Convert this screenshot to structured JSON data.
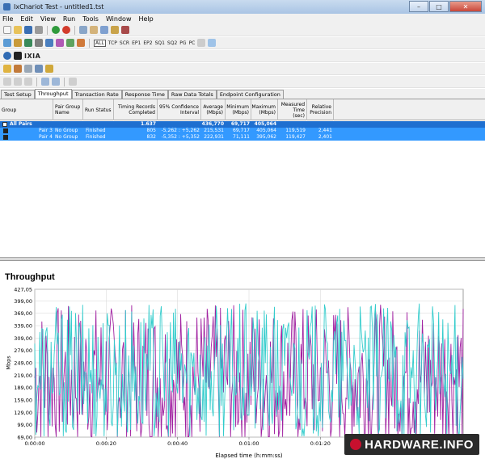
{
  "window": {
    "title": "IxChariot Test - untitled1.tst",
    "buttons": [
      "–",
      "□",
      "✕"
    ]
  },
  "menu": [
    "File",
    "Edit",
    "View",
    "Run",
    "Tools",
    "Window",
    "Help"
  ],
  "toolbar2_protocols": [
    "ALL",
    "TCP",
    "SCR",
    "EP1",
    "EP2",
    "SQ1",
    "SQ2",
    "PG",
    "PC"
  ],
  "brand_toolbar": {
    "label": "IXIA"
  },
  "tabs": [
    "Test Setup",
    "Throughput",
    "Transaction Rate",
    "Response Time",
    "Raw Data Totals",
    "Endpoint Configuration"
  ],
  "active_tab": "Throughput",
  "table": {
    "headers": [
      "Group",
      "Pair Group Name",
      "Run Status",
      "Timing Records Completed",
      "95% Confidence Interval",
      "Average (Mbps)",
      "Minimum (Mbps)",
      "Maximum (Mbps)",
      "Measured Time (sec)",
      "Relative Precision"
    ],
    "rows": [
      {
        "group": "All Pairs",
        "pg": "",
        "status": "",
        "timing": "1.637",
        "ci": "",
        "avg": "436,770",
        "min": "69,717",
        "max": "405,064",
        "time": "",
        "prec": ""
      },
      {
        "group": "Pair 3",
        "pg": "No Group",
        "status": "Finished",
        "timing": "805",
        "ci": "-5,262 : +5,262",
        "avg": "215,531",
        "min": "69,717",
        "max": "405,064",
        "time": "119,519",
        "prec": "2,441"
      },
      {
        "group": "Pair 4",
        "pg": "No Group",
        "status": "Finished",
        "timing": "832",
        "ci": "-5,352 : +5,352",
        "avg": "222,931",
        "min": "71,111",
        "max": "395,062",
        "time": "119,427",
        "prec": "2,401"
      }
    ]
  },
  "chart_data": {
    "type": "line",
    "title": "Throughput",
    "xlabel": "Elapsed time (h:mm:ss)",
    "ylabel": "Mbps",
    "ylim": [
      69.0,
      427.05
    ],
    "yticks": [
      "427,05",
      "399,00",
      "369,00",
      "339,00",
      "309,00",
      "279,00",
      "249,00",
      "219,00",
      "189,00",
      "159,00",
      "129,00",
      "99,00",
      "69,00"
    ],
    "xticks": [
      "0:00:00",
      "0:00:20",
      "0:00:40",
      "0:01:00",
      "0:01:20"
    ],
    "xlim_seconds": [
      0,
      120
    ],
    "series": [
      {
        "name": "Pair 3",
        "color": "#a020a0",
        "min": 69.717,
        "max": 405.064,
        "avg": 215.531
      },
      {
        "name": "Pair 4",
        "color": "#33cccc",
        "min": 71.111,
        "max": 395.062,
        "avg": 222.931
      }
    ],
    "grid": true
  },
  "watermark": {
    "text": "HARDWARE.INFO"
  }
}
